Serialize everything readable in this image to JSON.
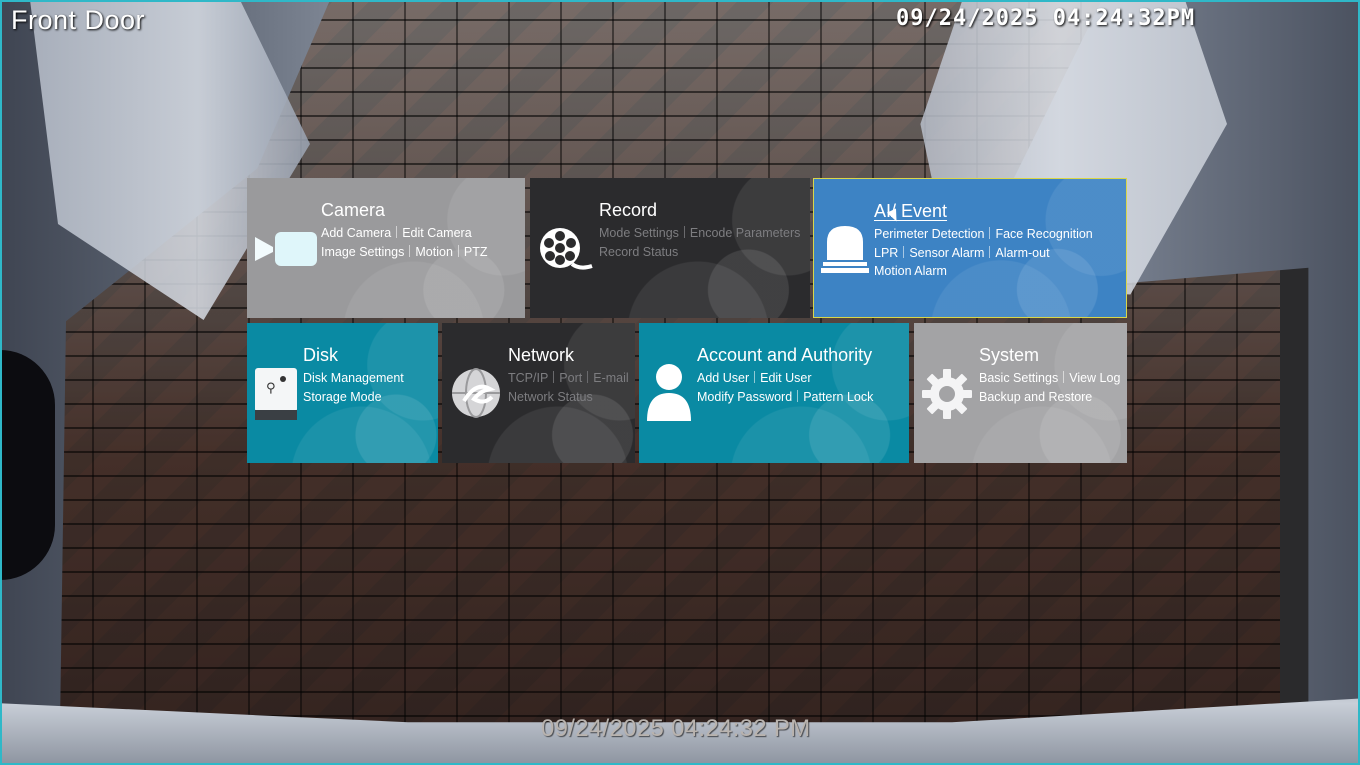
{
  "overlay": {
    "camera_name": "Front Door",
    "timestamp_top": "09/24/2025 04:24:32PM",
    "timestamp_bottom": "09/24/2025 04:24:32 PM"
  },
  "menu": {
    "camera": {
      "title": "Camera",
      "icon": "video-camera-icon",
      "links": [
        [
          "Add Camera",
          "Edit Camera"
        ],
        [
          "Image Settings",
          "Motion",
          "PTZ"
        ]
      ]
    },
    "record": {
      "title": "Record",
      "icon": "film-reel-icon",
      "links": [
        [
          "Mode Settings",
          "Encode Parameters"
        ],
        [
          "Record Status"
        ]
      ]
    },
    "ai_event": {
      "title": "AI/ Event",
      "icon": "alarm-siren-icon",
      "selected": true,
      "links": [
        [
          "Perimeter Detection",
          "Face Recognition"
        ],
        [
          "LPR",
          "Sensor Alarm",
          "Alarm-out"
        ],
        [
          "Motion Alarm"
        ]
      ]
    },
    "disk": {
      "title": "Disk",
      "icon": "hard-disk-icon",
      "links": [
        [
          "Disk Management"
        ],
        [
          "Storage Mode"
        ]
      ]
    },
    "network": {
      "title": "Network",
      "icon": "globe-network-icon",
      "links": [
        [
          "TCP/IP",
          "Port",
          "E-mail"
        ],
        [
          "Network Status"
        ]
      ]
    },
    "account": {
      "title": "Account and Authority",
      "icon": "user-icon",
      "links": [
        [
          "Add User",
          "Edit User"
        ],
        [
          "Modify Password",
          "Pattern Lock"
        ]
      ]
    },
    "system": {
      "title": "System",
      "icon": "gear-icon",
      "links": [
        [
          "Basic Settings",
          "View Log"
        ],
        [
          "Backup and Restore"
        ]
      ]
    }
  },
  "colors": {
    "frame": "#2fb8c8",
    "camera_tile": "#9a9a9c",
    "record_tile": "#2b2b2d",
    "ai_tile": "#3d83c4",
    "teal_tile": "#0a8aa3",
    "system_tile": "#a3a3a5",
    "selection_border": "#d9d64a"
  }
}
